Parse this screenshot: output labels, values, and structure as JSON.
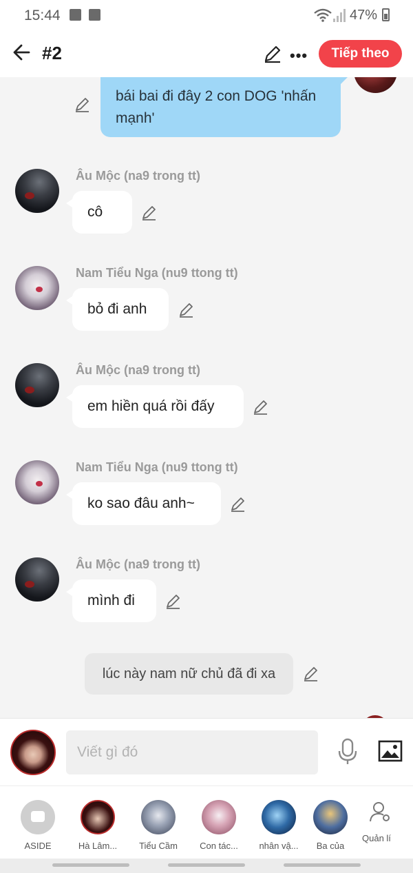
{
  "status_bar": {
    "time": "15:44",
    "battery": "47%"
  },
  "header": {
    "title": "#2",
    "next_label": "Tiếp theo"
  },
  "self_message": {
    "text": "bái bai đi đây 2 con DOG 'nhấn mạnh'"
  },
  "messages": [
    {
      "sender": "Âu Mộc (na9 trong tt)",
      "text": "cô",
      "avatar": "dark"
    },
    {
      "sender": "Nam Tiểu Nga (nu9 ttong tt)",
      "text": "bỏ đi anh",
      "avatar": "white"
    },
    {
      "sender": "Âu Mộc (na9 trong tt)",
      "text": "em hiền quá rồi đấy",
      "avatar": "dark"
    },
    {
      "sender": "Nam Tiểu Nga (nu9 ttong tt)",
      "text": "ko sao đâu anh~",
      "avatar": "white"
    },
    {
      "sender": "Âu Mộc (na9 trong tt)",
      "text": "mình đi",
      "avatar": "dark"
    }
  ],
  "narration": {
    "text": "lúc này nam nữ chủ đã đi xa"
  },
  "composer": {
    "placeholder": "Viết gì đó"
  },
  "characters": [
    {
      "label": "ASIDE"
    },
    {
      "label": "Hà Lâm..."
    },
    {
      "label": "Tiểu Cầm"
    },
    {
      "label": "Con tác..."
    },
    {
      "label": "nhân vậ..."
    },
    {
      "label": "Ba của"
    }
  ],
  "manage": {
    "label": "Quản lí"
  },
  "colors": {
    "accent": "#f2434a",
    "self_bubble": "#9fd7f7",
    "background": "#f4f4f4"
  },
  "icons": [
    "back-arrow-icon",
    "pencil-icon",
    "more-icon",
    "mic-icon",
    "image-icon",
    "manage-user-icon",
    "wifi-icon",
    "signal-icon",
    "battery-icon"
  ]
}
